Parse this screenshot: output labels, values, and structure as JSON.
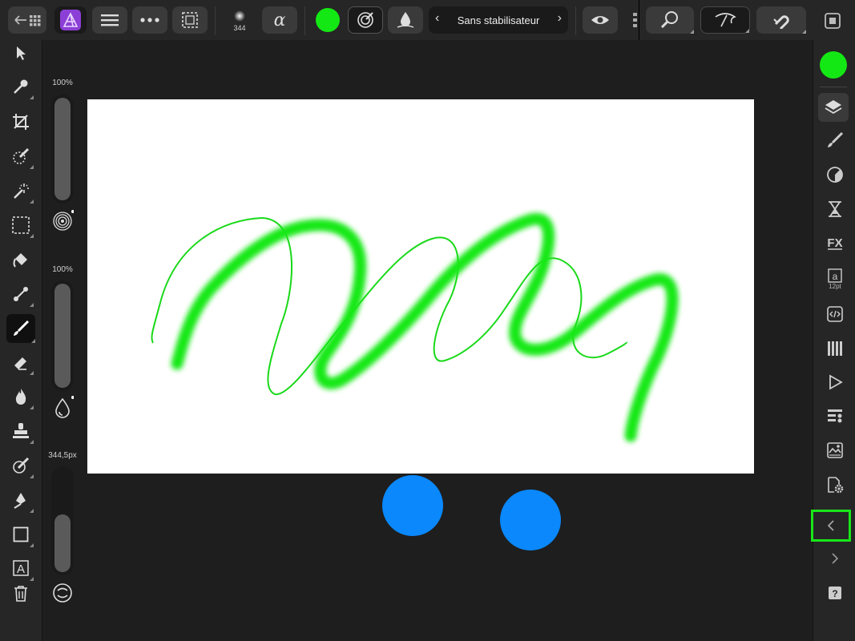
{
  "app": {
    "name": "Affinity Photo"
  },
  "topbar": {
    "brush_size": "344",
    "stabilizer_label": "Sans stabilisateur"
  },
  "colors": {
    "primary": "#14e814",
    "panel": "#262626",
    "canvas_bg": "#1e1e1e",
    "highlight": "#19e619",
    "blue_touch": "#0a88fc"
  },
  "left_tools": [
    {
      "icon": "move-icon"
    },
    {
      "icon": "color-picker-icon"
    },
    {
      "icon": "crop-icon"
    },
    {
      "icon": "selection-brush-icon"
    },
    {
      "icon": "magic-wand-icon"
    },
    {
      "icon": "marquee-icon"
    },
    {
      "icon": "flood-fill-icon"
    },
    {
      "icon": "gradient-icon"
    },
    {
      "icon": "paint-brush-icon"
    },
    {
      "icon": "eraser-icon"
    },
    {
      "icon": "dodge-icon"
    },
    {
      "icon": "clone-stamp-icon"
    },
    {
      "icon": "retouch-icon"
    },
    {
      "icon": "pen-icon"
    },
    {
      "icon": "rectangle-icon"
    },
    {
      "icon": "text-frame-icon"
    },
    {
      "icon": "trash-icon"
    }
  ],
  "sliders": {
    "opacity": {
      "label": "100%",
      "level": 1.0
    },
    "flow": {
      "label": "100%",
      "level": 1.0
    },
    "width": {
      "label": "344,5px",
      "level": 0.55
    }
  },
  "right_panels": [
    {
      "icon": "color-swatch-icon"
    },
    {
      "icon": "layers-icon"
    },
    {
      "icon": "brushes-icon"
    },
    {
      "icon": "adjustments-icon"
    },
    {
      "icon": "history-icon"
    },
    {
      "icon": "fx-icon"
    },
    {
      "icon": "text-styles-icon",
      "label": "12pt"
    },
    {
      "icon": "transform-icon"
    },
    {
      "icon": "channels-icon"
    },
    {
      "icon": "macros-icon"
    },
    {
      "icon": "navigator-icon"
    },
    {
      "icon": "stock-icon"
    },
    {
      "icon": "settings-icon"
    },
    {
      "icon": "collapse-left-icon"
    },
    {
      "icon": "expand-right-icon"
    },
    {
      "icon": "help-icon"
    }
  ]
}
